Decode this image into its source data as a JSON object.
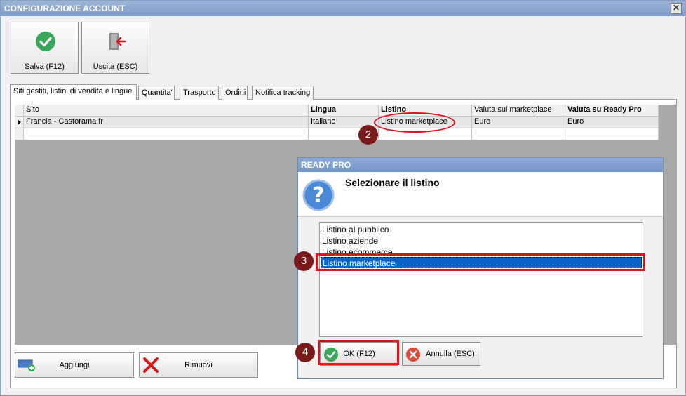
{
  "window": {
    "title": "CONFIGURAZIONE ACCOUNT",
    "close_glyph": "✕"
  },
  "toolbar": {
    "save": {
      "label": "Salva (F12)",
      "icon": "check-circle-icon"
    },
    "exit": {
      "label": "Uscita (ESC)",
      "icon": "exit-door-icon"
    }
  },
  "tabs": [
    {
      "label": "Siti gestiti, listini di vendita e lingue",
      "active": true
    },
    {
      "label": "Quantita'",
      "active": false
    },
    {
      "label": "Trasporto",
      "active": false
    },
    {
      "label": "Ordini",
      "active": false
    },
    {
      "label": "Notifica tracking",
      "active": false
    }
  ],
  "grid": {
    "columns": [
      "Sito",
      "Lingua",
      "Listino",
      "Valuta sul marketplace",
      "Valuta su Ready Pro"
    ],
    "rows": [
      {
        "sito": "Francia - Castorama.fr",
        "lingua": "Italiano",
        "listino": "Listino marketplace",
        "valuta_marketplace": "Euro",
        "valuta_ready": "Euro"
      }
    ]
  },
  "callouts": {
    "step2": "2",
    "step3": "3",
    "step4": "4"
  },
  "dialog": {
    "title": "READY PRO",
    "heading": "Selezionare il listino",
    "items": [
      "Listino al pubblico",
      "Listino aziende",
      "Listino ecommerce",
      "Listino marketplace"
    ],
    "selected_index": 3,
    "ok_label": "OK (F12)",
    "cancel_label": "Annulla (ESC)"
  },
  "bottom": {
    "add_label": "Aggiungi",
    "remove_label": "Rimuovi"
  },
  "colors": {
    "accent_red": "#d9141b",
    "badge": "#7a1a1a",
    "selection": "#0a64c8",
    "check_green": "#3aa85a"
  }
}
